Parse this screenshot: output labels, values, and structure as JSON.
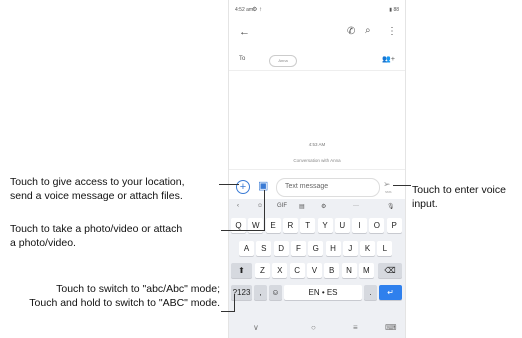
{
  "callouts": {
    "location": {
      "line1": "Touch to give access to your location,",
      "line2": "send a voice message or attach files."
    },
    "photo": {
      "line1": "Touch to take a photo/video or attach",
      "line2": "a photo/video."
    },
    "mode": {
      "line1": "Touch to switch to \"abc/Abc\" mode;",
      "line2": "Touch and hold to switch to \"ABC\" mode."
    },
    "voice": {
      "line1": "Touch to enter voice",
      "line2": "input."
    }
  },
  "phone": {
    "status": {
      "time": "4:52 am",
      "gear": "⚙ ↑",
      "battery": "▮ 88"
    },
    "topbar": {
      "back": "←",
      "call": "✆",
      "search": "⌕",
      "more": "⋮"
    },
    "to_label": "To",
    "recipient_chip": "Anna",
    "add_group": "👥+",
    "timestamp": "4:53 AM",
    "conversation_label": "Conversation with Anna",
    "composer": {
      "plus": "+",
      "gallery": "▣",
      "placeholder": "Text message",
      "send": "➢",
      "send_label": "SMS"
    },
    "suggestion_bar": [
      "‹",
      "☺",
      "GIF",
      "▤",
      "⚙",
      "···",
      "🎙"
    ],
    "keyboard": {
      "row1": [
        "Q",
        "W",
        "E",
        "R",
        "T",
        "Y",
        "U",
        "I",
        "O",
        "P"
      ],
      "row2": [
        "A",
        "S",
        "D",
        "F",
        "G",
        "H",
        "J",
        "K",
        "L"
      ],
      "row3_keys": [
        "Z",
        "X",
        "C",
        "V",
        "B",
        "N",
        "M"
      ],
      "shift": "⬆",
      "backspace": "⌫",
      "symbols": "?123",
      "comma": ",",
      "emoji": "☺",
      "space": "EN • ES",
      "period": ".",
      "enter": "↵"
    },
    "navbar": {
      "back": "∨",
      "home": "○",
      "recents": "≡",
      "keyboard": "⌨"
    }
  }
}
